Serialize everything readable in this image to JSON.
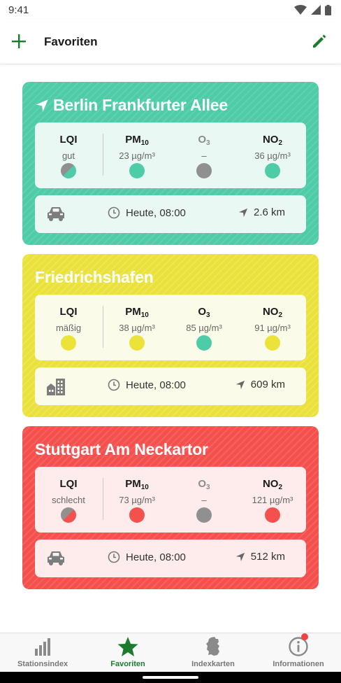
{
  "status_bar": {
    "time": "9:41"
  },
  "toolbar": {
    "title": "Favoriten",
    "add_icon": "plus-icon",
    "edit_icon": "pencil-icon"
  },
  "colors": {
    "green_card": "#4ecba7",
    "yellow_card": "#eae23a",
    "red_card": "#f4504d",
    "dot_green": "#4ecba7",
    "dot_yellow": "#ece33a",
    "dot_red": "#f4504d",
    "dot_gray": "#909090",
    "accent": "#1b7b2e"
  },
  "stations": [
    {
      "name": "Berlin Frankfurter Allee",
      "has_location": true,
      "lqi": {
        "label": "LQI",
        "value": "gut"
      },
      "pm10": {
        "label": "PM",
        "sub": "10",
        "value": "23 µg/m³"
      },
      "o3": {
        "label": "O",
        "sub": "3",
        "value": "–"
      },
      "no2": {
        "label": "NO",
        "sub": "2",
        "value": "36 µg/m³"
      },
      "station_type": "car-icon",
      "time": "Heute, 08:00",
      "distance": "2.6 km"
    },
    {
      "name": "Friedrichshafen",
      "has_location": false,
      "lqi": {
        "label": "LQI",
        "value": "mäßig"
      },
      "pm10": {
        "label": "PM",
        "sub": "10",
        "value": "38 µg/m³"
      },
      "o3": {
        "label": "O",
        "sub": "3",
        "value": "85 µg/m³"
      },
      "no2": {
        "label": "NO",
        "sub": "2",
        "value": "91 µg/m³"
      },
      "station_type": "city-icon",
      "time": "Heute, 08:00",
      "distance": "609 km"
    },
    {
      "name": "Stuttgart Am Neckartor",
      "has_location": false,
      "lqi": {
        "label": "LQI",
        "value": "schlecht"
      },
      "pm10": {
        "label": "PM",
        "sub": "10",
        "value": "73 µg/m³"
      },
      "o3": {
        "label": "O",
        "sub": "3",
        "value": "–"
      },
      "no2": {
        "label": "NO",
        "sub": "2",
        "value": "121 µg/m³"
      },
      "station_type": "car-icon",
      "time": "Heute, 08:00",
      "distance": "512 km"
    }
  ],
  "bottom_nav": [
    {
      "label": "Stationsindex",
      "icon": "bar-chart-icon",
      "active": false
    },
    {
      "label": "Favoriten",
      "icon": "star-icon",
      "active": true
    },
    {
      "label": "Indexkarten",
      "icon": "germany-map-icon",
      "active": false
    },
    {
      "label": "Informationen",
      "icon": "info-icon",
      "active": false,
      "badge": true
    }
  ]
}
